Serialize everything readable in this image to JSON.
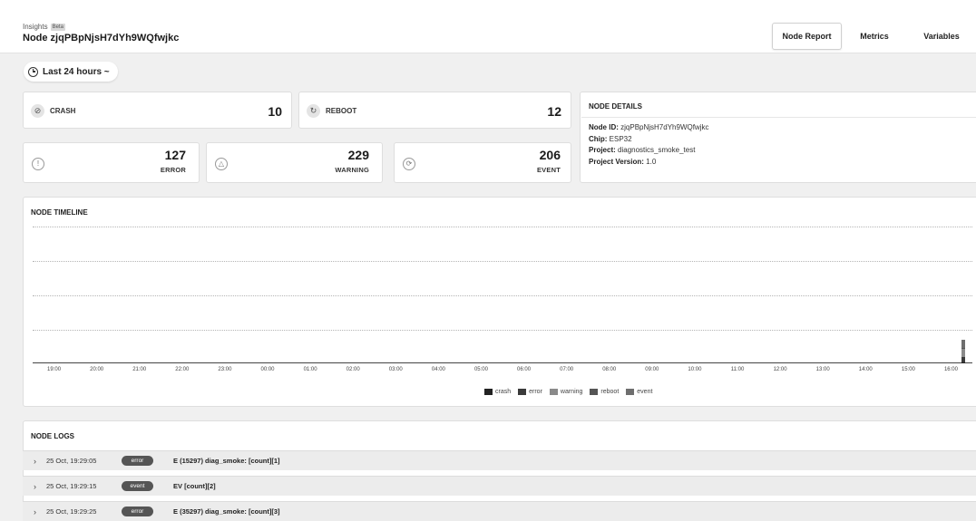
{
  "header": {
    "breadcrumb": "Insights",
    "beta": "Beta",
    "title": "Node zjqPBpNjsH7dYh9WQfwjkc",
    "tabs": [
      {
        "label": "Node Report",
        "active": true
      },
      {
        "label": "Metrics",
        "active": false
      },
      {
        "label": "Variables",
        "active": false
      }
    ]
  },
  "time_range": {
    "label": "Last 24 hours ~"
  },
  "stats": {
    "crash": {
      "label": "CRASH",
      "value": "10"
    },
    "reboot": {
      "label": "REBOOT",
      "value": "12"
    },
    "error": {
      "label": "ERROR",
      "value": "127"
    },
    "warning": {
      "label": "WARNING",
      "value": "229"
    },
    "event": {
      "label": "EVENT",
      "value": "206"
    }
  },
  "node_details": {
    "heading": "NODE DETAILS",
    "rows": [
      {
        "key": "Node ID:",
        "value": "zjqPBpNjsH7dYh9WQfwjkc"
      },
      {
        "key": "Chip:",
        "value": "ESP32"
      },
      {
        "key": "Project:",
        "value": "diagnostics_smoke_test"
      },
      {
        "key": "Project Version:",
        "value": "1.0"
      }
    ]
  },
  "timeline": {
    "heading": "NODE TIMELINE",
    "legend": [
      {
        "name": "crash",
        "color": "#222222"
      },
      {
        "name": "error",
        "color": "#3a3a3a"
      },
      {
        "name": "warning",
        "color": "#8a8a8a"
      },
      {
        "name": "reboot",
        "color": "#555555"
      },
      {
        "name": "event",
        "color": "#6e6e6e"
      }
    ]
  },
  "chart_data": {
    "type": "bar",
    "categories": [
      "19:00",
      "20:00",
      "21:00",
      "22:00",
      "23:00",
      "00:00",
      "01:00",
      "02:00",
      "03:00",
      "04:00",
      "05:00",
      "06:00",
      "07:00",
      "08:00",
      "09:00",
      "10:00",
      "11:00",
      "12:00",
      "13:00",
      "14:00",
      "15:00",
      "16:00"
    ],
    "stacked": true,
    "series": [
      {
        "name": "crash",
        "values": [
          0,
          0,
          0,
          0,
          0,
          0,
          0,
          0,
          0,
          0,
          0,
          0,
          0,
          0,
          0,
          0,
          0,
          0,
          0,
          0,
          0,
          10
        ]
      },
      {
        "name": "error",
        "values": [
          0,
          0,
          0,
          0,
          0,
          0,
          0,
          0,
          0,
          0,
          0,
          0,
          0,
          0,
          0,
          0,
          0,
          0,
          0,
          0,
          0,
          127
        ]
      },
      {
        "name": "warning",
        "values": [
          0,
          0,
          0,
          0,
          0,
          0,
          0,
          0,
          0,
          0,
          0,
          0,
          0,
          0,
          0,
          0,
          0,
          0,
          0,
          0,
          0,
          229
        ]
      },
      {
        "name": "reboot",
        "values": [
          0,
          0,
          0,
          0,
          0,
          0,
          0,
          0,
          0,
          0,
          0,
          0,
          0,
          0,
          0,
          0,
          0,
          0,
          0,
          0,
          0,
          12
        ]
      },
      {
        "name": "event",
        "values": [
          0,
          0,
          0,
          0,
          0,
          0,
          0,
          0,
          0,
          0,
          0,
          0,
          0,
          0,
          0,
          0,
          0,
          0,
          0,
          0,
          0,
          206
        ]
      }
    ],
    "ylim": [
      0,
      3500
    ],
    "grid": true,
    "legend_position": "bottom-center",
    "xlabel": "",
    "ylabel": ""
  },
  "logs": {
    "heading": "NODE LOGS",
    "rows": [
      {
        "time": "25 Oct, 19:29:05",
        "level": "error",
        "message": "E (15297) diag_smoke: [count][1]"
      },
      {
        "time": "25 Oct, 19:29:15",
        "level": "event",
        "message": "EV [count][2]"
      },
      {
        "time": "25 Oct, 19:29:25",
        "level": "error",
        "message": "E (35297) diag_smoke: [count][3]"
      }
    ]
  }
}
